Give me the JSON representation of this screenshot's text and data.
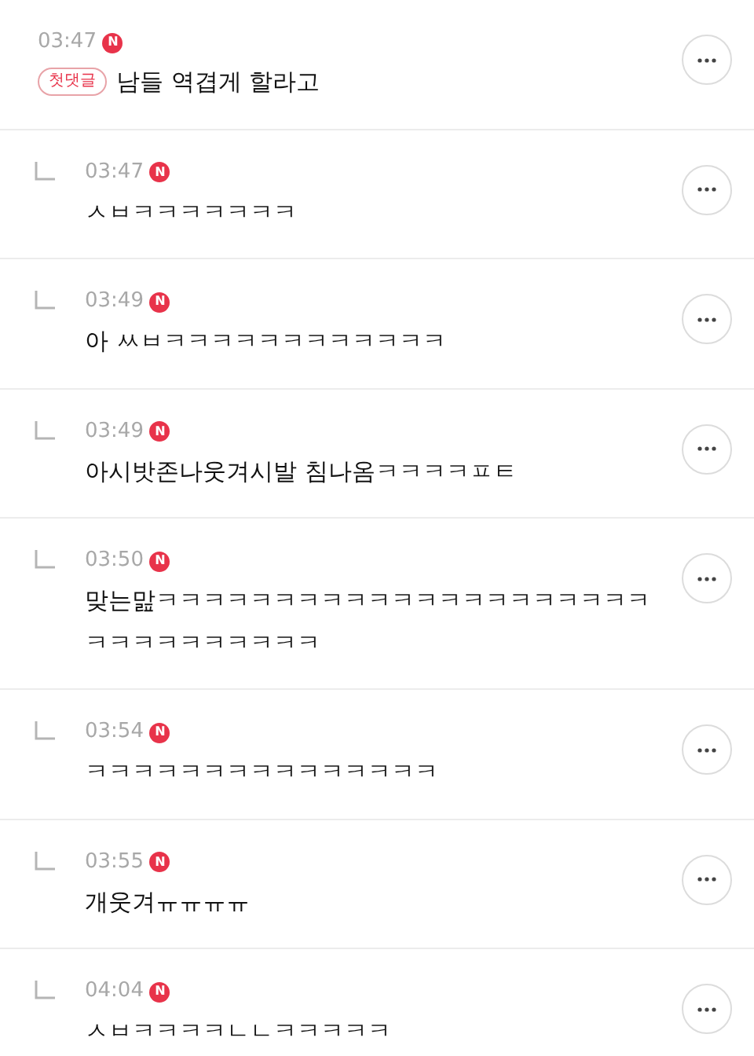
{
  "comments": [
    {
      "kind": "comment",
      "time": "03:47",
      "new_badge": "N",
      "label": "첫댓글",
      "text": "남들 역겹게 할라고"
    },
    {
      "kind": "reply",
      "time": "03:47",
      "new_badge": "N",
      "text": "ㅅㅂㅋㅋㅋㅋㅋㅋㅋ"
    },
    {
      "kind": "reply",
      "time": "03:49",
      "new_badge": "N",
      "text": "아 ㅆㅂㅋㅋㅋㅋㅋㅋㅋㅋㅋㅋㅋㅋ"
    },
    {
      "kind": "reply",
      "time": "03:49",
      "new_badge": "N",
      "text": "아시밧존나웃겨시발 침나옴ㅋㅋㅋㅋㅍㅌ"
    },
    {
      "kind": "reply",
      "time": "03:50",
      "new_badge": "N",
      "text": "맞는맖ㅋㅋㅋㅋㅋㅋㅋㅋㅋㅋㅋㅋㅋㅋㅋㅋㅋㅋㅋㅋㅋ",
      "text_2": "ㅋㅋㅋㅋㅋㅋㅋㅋㅋㅋ"
    },
    {
      "kind": "reply",
      "time": "03:54",
      "new_badge": "N",
      "text": "ㅋㅋㅋㅋㅋㅋㅋㅋㅋㅋㅋㅋㅋㅋㅋ"
    },
    {
      "kind": "reply",
      "time": "03:55",
      "new_badge": "N",
      "text": "개웃겨ㅠㅠㅠㅠ"
    },
    {
      "kind": "reply",
      "time": "04:04",
      "new_badge": "N",
      "text": "ㅅㅂㅋㅋㅋㅋㄴㄴㅋㅋㅋㅋㅋ"
    }
  ]
}
